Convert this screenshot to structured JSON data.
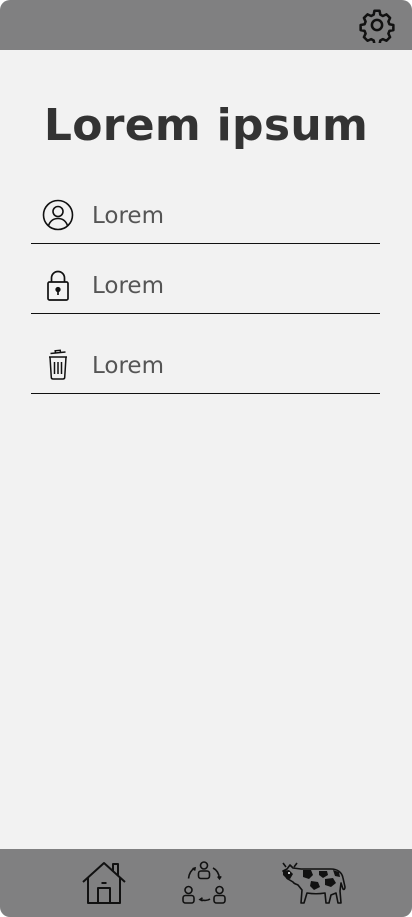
{
  "header": {
    "settings_icon": "gear-icon"
  },
  "main": {
    "title": "Lorem ipsum",
    "fields": [
      {
        "icon": "user-circle-icon",
        "label": "Lorem"
      },
      {
        "icon": "lock-icon",
        "label": "Lorem"
      },
      {
        "icon": "trash-icon",
        "label": "Lorem"
      }
    ]
  },
  "bottom_nav": {
    "items": [
      {
        "icon": "home-icon"
      },
      {
        "icon": "group-cycle-icon"
      },
      {
        "icon": "cow-icon"
      }
    ]
  },
  "colors": {
    "bar": "#808081",
    "background": "#f2f2f2",
    "title": "#333333",
    "label": "#555555"
  }
}
